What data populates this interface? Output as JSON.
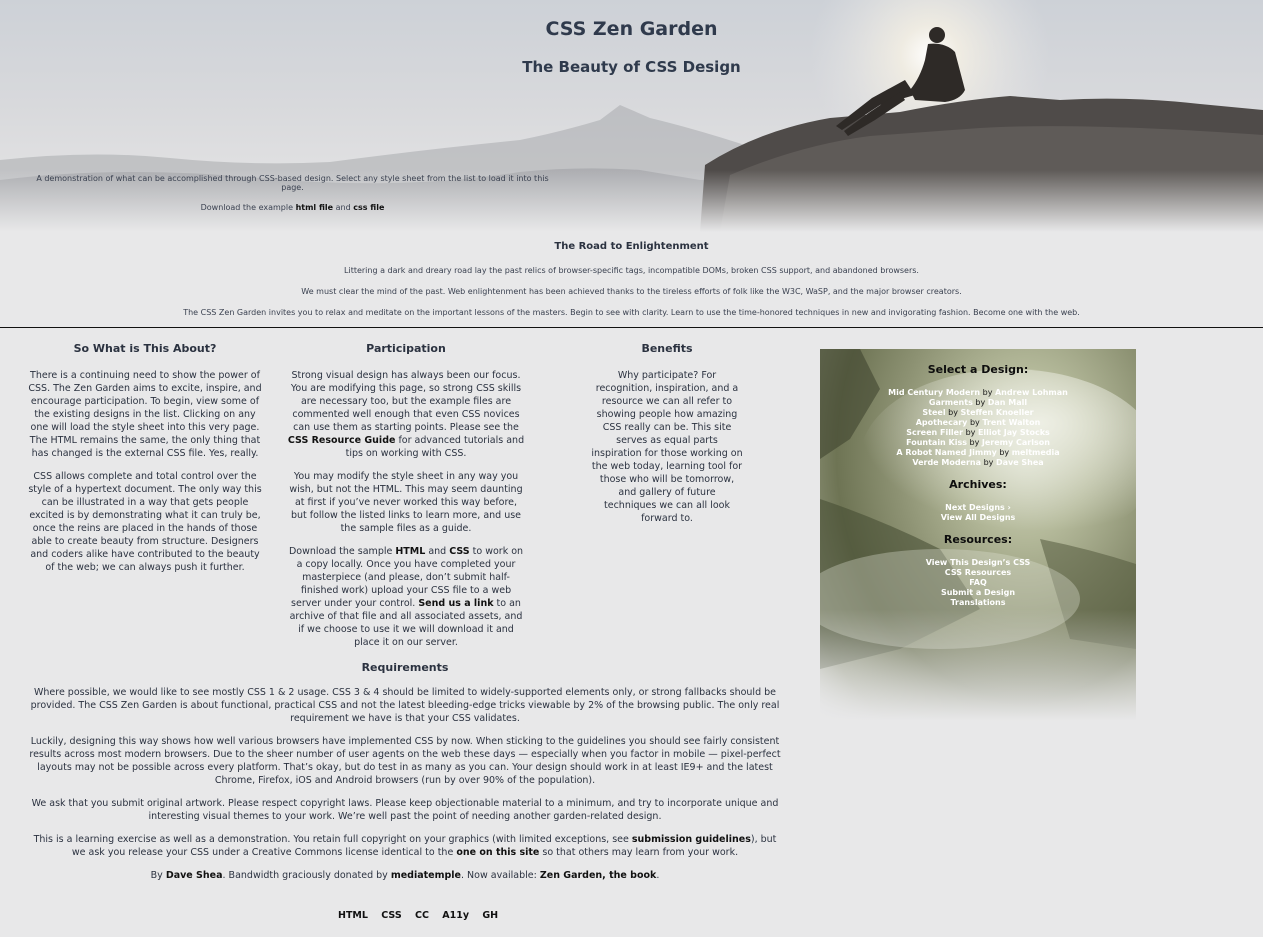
{
  "header": {
    "title": "CSS Zen Garden",
    "subtitle": "The Beauty of CSS Design"
  },
  "summary": {
    "line1": "A demonstration of what can be accomplished through CSS-based design. Select any style sheet from the list to load it into this page.",
    "download_prefix": "Download the example",
    "html_link": "html file",
    "and": "and",
    "css_link": "css file"
  },
  "preamble": {
    "title": "The Road to Enlightenment",
    "p1": "Littering a dark and dreary road lay the past relics of browser-specific tags, incompatible DOMs, broken CSS support, and abandoned browsers.",
    "p2": "We must clear the mind of the past. Web enlightenment has been achieved thanks to the tireless efforts of folk like the W3C, WaSP, and the major browser creators.",
    "p3": "The CSS Zen Garden invites you to relax and meditate on the important lessons of the masters. Begin to see with clarity. Learn to use the time-honored techniques in new and invigorating fashion. Become one with the web."
  },
  "explanation": {
    "title": "So What is This About?",
    "p1": "There is a continuing need to show the power of CSS. The Zen Garden aims to excite, inspire, and encourage participation. To begin, view some of the existing designs in the list. Clicking on any one will load the style sheet into this very page. The HTML remains the same, the only thing that has changed is the external CSS file. Yes, really.",
    "p2": "CSS allows complete and total control over the style of a hypertext document. The only way this can be illustrated in a way that gets people excited is by demonstrating what it can truly be, once the reins are placed in the hands of those able to create beauty from structure. Designers and coders alike have contributed to the beauty of the web; we can always push it further."
  },
  "participation": {
    "title": "Participation",
    "p1_a": "Strong visual design has always been our focus. You are modifying this page, so strong CSS skills are necessary too, but the example files are commented well enough that even CSS novices can use them as starting points. Please see the ",
    "p1_link": "CSS Resource Guide",
    "p1_b": " for advanced tutorials and tips on working with CSS.",
    "p2": "You may modify the style sheet in any way you wish, but not the HTML. This may seem daunting at first if you’ve never worked this way before, but follow the listed links to learn more, and use the sample files as a guide.",
    "p3_a": "Download the sample ",
    "p3_html": "HTML",
    "p3_and": " and ",
    "p3_css": "CSS",
    "p3_b": " to work on a copy locally. Once you have completed your masterpiece (and please, don’t submit half-finished work) upload your CSS file to a web server under your control. ",
    "p3_link": "Send us a link",
    "p3_c": " to an archive of that file and all associated assets, and if we choose to use it we will download it and place it on our server."
  },
  "benefits": {
    "title": "Benefits",
    "p1": "Why participate? For recognition, inspiration, and a resource we can all refer to showing people how amazing CSS really can be. This site serves as equal parts inspiration for those working on the web today, learning tool for those who will be tomorrow, and gallery of future techniques we can all look forward to."
  },
  "requirements": {
    "title": "Requirements",
    "p1": "Where possible, we would like to see mostly CSS 1 & 2 usage. CSS 3 & 4 should be limited to widely-supported elements only, or strong fallbacks should be provided. The CSS Zen Garden is about functional, practical CSS and not the latest bleeding-edge tricks viewable by 2% of the browsing public. The only real requirement we have is that your CSS validates.",
    "p2": "Luckily, designing this way shows how well various browsers have implemented CSS by now. When sticking to the guidelines you should see fairly consistent results across most modern browsers. Due to the sheer number of user agents on the web these days — especially when you factor in mobile — pixel-perfect layouts may not be possible across every platform. That’s okay, but do test in as many as you can. Your design should work in at least IE9+ and the latest Chrome, Firefox, iOS and Android browsers (run by over 90% of the population).",
    "p3": "We ask that you submit original artwork. Please respect copyright laws. Please keep objectionable material to a minimum, and try to incorporate unique and interesting visual themes to your work. We’re well past the point of needing another garden-related design.",
    "p4_a": "This is a learning exercise as well as a demonstration. You retain full copyright on your graphics (with limited exceptions, see ",
    "p4_link1": "submission guidelines",
    "p4_b": "), but we ask you release your CSS under a Creative Commons license identical to the ",
    "p4_link2": "one on this site",
    "p4_c": " so that others may learn from your work.",
    "credit_by": "By ",
    "credit_author": "Dave Shea",
    "credit_mid": ". Bandwidth graciously donated by ",
    "credit_host": "mediatemple",
    "credit_mid2": ". Now available: ",
    "credit_book": "Zen Garden, the book",
    "credit_end": "."
  },
  "footer": {
    "links": [
      "HTML",
      "CSS",
      "CC",
      "A11y",
      "GH"
    ]
  },
  "sidebar": {
    "select_title": "Select a Design:",
    "by": "by",
    "designs": [
      {
        "name": "Mid Century Modern",
        "author": "Andrew Lohman"
      },
      {
        "name": "Garments",
        "author": "Dan Mall"
      },
      {
        "name": "Steel",
        "author": "Steffen Knoeller"
      },
      {
        "name": "Apothecary",
        "author": "Trent Walton"
      },
      {
        "name": "Screen Filler",
        "author": "Elliot Jay Stocks"
      },
      {
        "name": "Fountain Kiss",
        "author": "Jeremy Carlson"
      },
      {
        "name": "A Robot Named Jimmy",
        "author": "meltmedia"
      },
      {
        "name": "Verde Moderna",
        "author": "Dave Shea"
      }
    ],
    "archives_title": "Archives:",
    "archives": [
      "Next Designs ›",
      "View All Designs"
    ],
    "resources_title": "Resources:",
    "resources": [
      "View This Design’s CSS",
      "CSS Resources",
      "FAQ",
      "Submit a Design",
      "Translations"
    ]
  }
}
